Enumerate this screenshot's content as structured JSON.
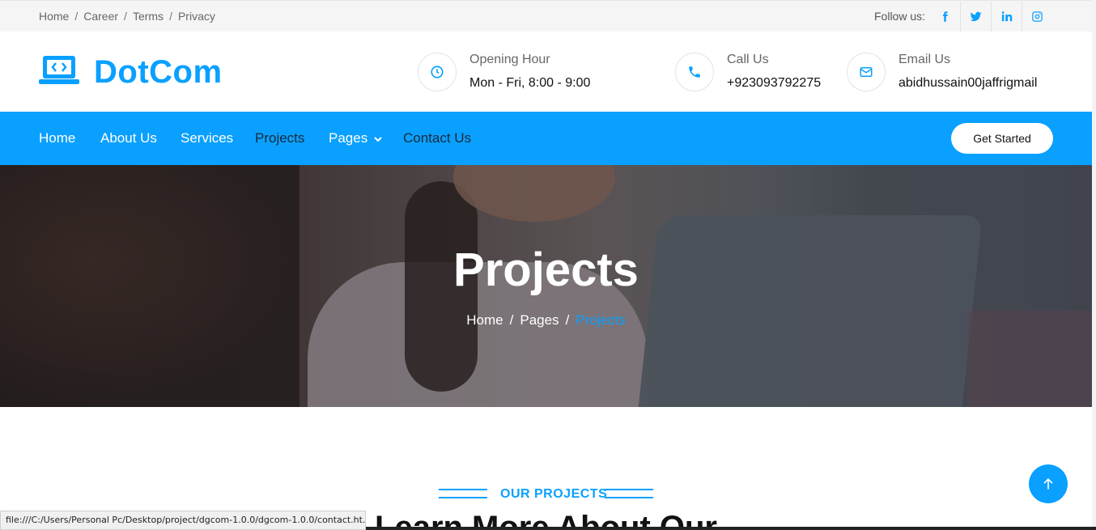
{
  "topbar": {
    "links": [
      "Home",
      "Career",
      "Terms",
      "Privacy"
    ],
    "follow_label": "Follow us:",
    "social": [
      "facebook-icon",
      "twitter-icon",
      "linkedin-icon",
      "instagram-icon"
    ]
  },
  "header": {
    "brand": "DotCom",
    "opening": {
      "label": "Opening Hour",
      "value": "Mon - Fri, 8:00 - 9:00"
    },
    "call": {
      "label": "Call Us",
      "value": "+923093792275"
    },
    "email": {
      "label": "Email Us",
      "value": "abidhussain00jaffrigmail"
    }
  },
  "nav": {
    "items": [
      "Home",
      "About Us",
      "Services",
      "Projects",
      "Pages",
      "Contact Us"
    ],
    "cta": "Get Started"
  },
  "hero": {
    "title": "Projects",
    "breadcrumb": [
      "Home",
      "Pages",
      "Projects"
    ]
  },
  "section": {
    "subtitle": "OUR PROJECTS",
    "title": "Learn More About Our"
  },
  "status_url": "file:///C:/Users/Personal Pc/Desktop/project/dgcom-1.0.0/dgcom-1.0.0/contact.ht...",
  "colors": {
    "primary": "#0aa0ff",
    "dark": "#1a2a3a"
  }
}
